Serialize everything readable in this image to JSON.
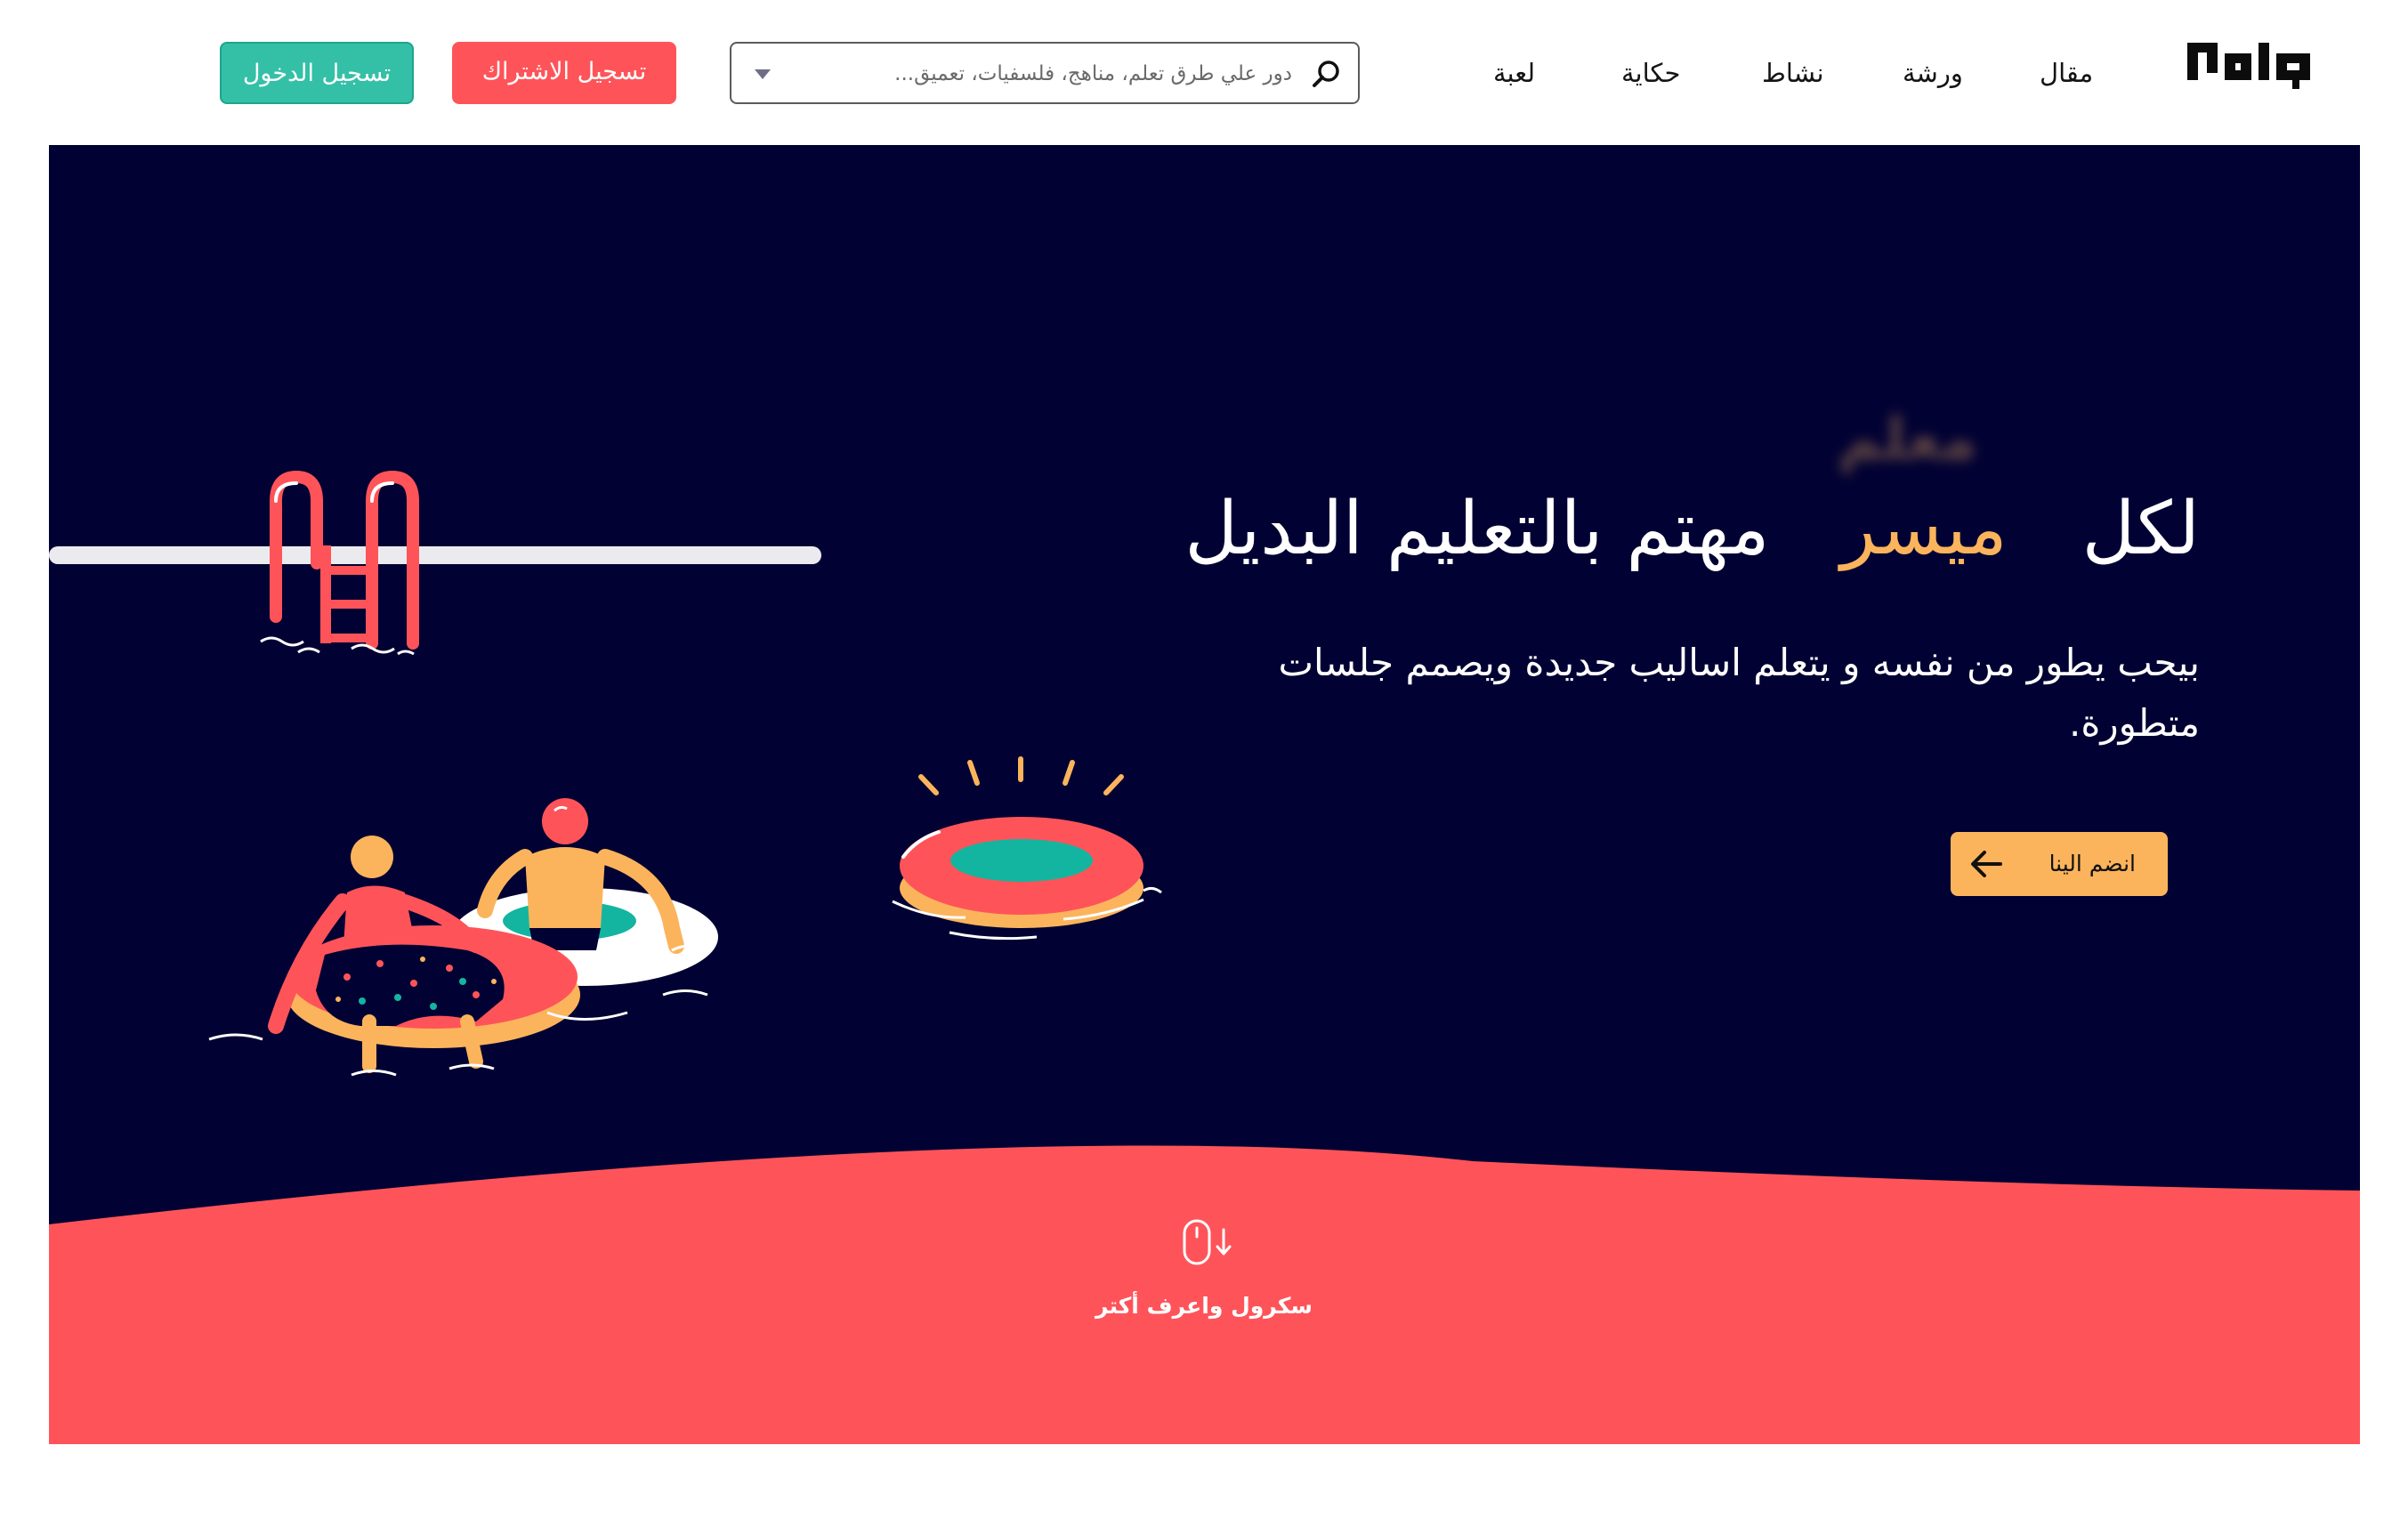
{
  "header": {
    "logo_alt": "موازي",
    "nav": [
      "مقال",
      "ورشة",
      "نشاط",
      "حكاية",
      "لعبة"
    ],
    "search": {
      "placeholder": "دور علي طرق تعلم، مناهج، فلسفيات، تعميق..."
    },
    "signup_label": "تسجيل الاشتراك",
    "login_label": "تسجيل الدخول"
  },
  "hero": {
    "ghost_word": "معلم",
    "headline_start": "لكل",
    "headline_accent": "ميسر",
    "headline_end": "مهتم بالتعليم البديل",
    "subtext": "بيحب يطور من نفسه و يتعلم اساليب جديدة ويصمم جلسات متطورة.",
    "cta_label": "انضم الينا",
    "scroll_label": "سكرول واعرف أكتر"
  },
  "colors": {
    "navy": "#010133",
    "coral": "#fe5459",
    "yellow": "#fbb45c",
    "teal": "#34c0a6",
    "white": "#ffffff"
  },
  "icons": [
    "search-icon",
    "chevron-down-icon",
    "arrow-left-icon",
    "mouse-scroll-icon",
    "pool-ladder-illustration",
    "swim-ring-illustration",
    "swimmers-illustration"
  ]
}
